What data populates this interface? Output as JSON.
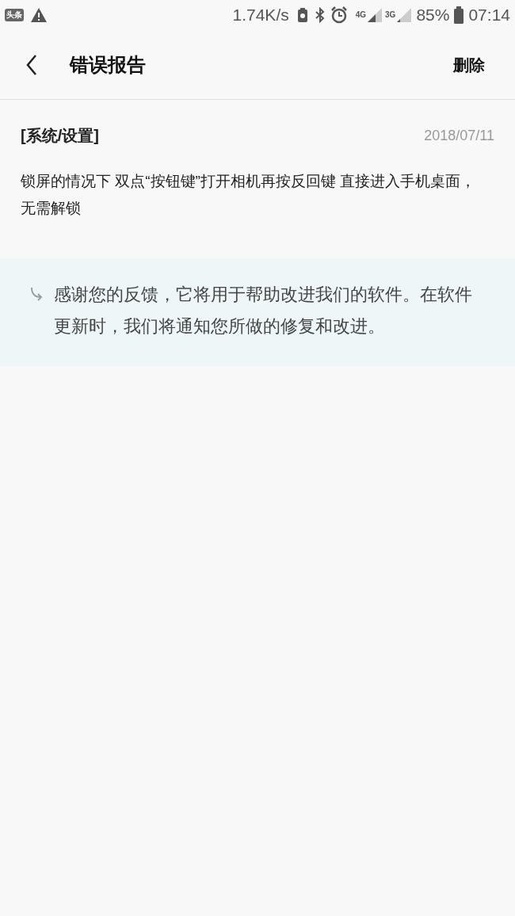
{
  "status_bar": {
    "app_badge": "头条",
    "speed": "1.74K/s",
    "network_1": "4G",
    "network_2": "3G",
    "battery": "85%",
    "time": "07:14"
  },
  "header": {
    "title": "错误报告",
    "action": "删除"
  },
  "report": {
    "category": "[系统/设置]",
    "date": "2018/07/11",
    "body": "锁屏的情况下 双点“按钮键”打开相机再按反回键 直接进入手机桌面，无需解锁"
  },
  "reply": {
    "text": "感谢您的反馈，它将用于帮助改进我们的软件。在软件更新时，我们将通知您所做的修复和改进。"
  }
}
